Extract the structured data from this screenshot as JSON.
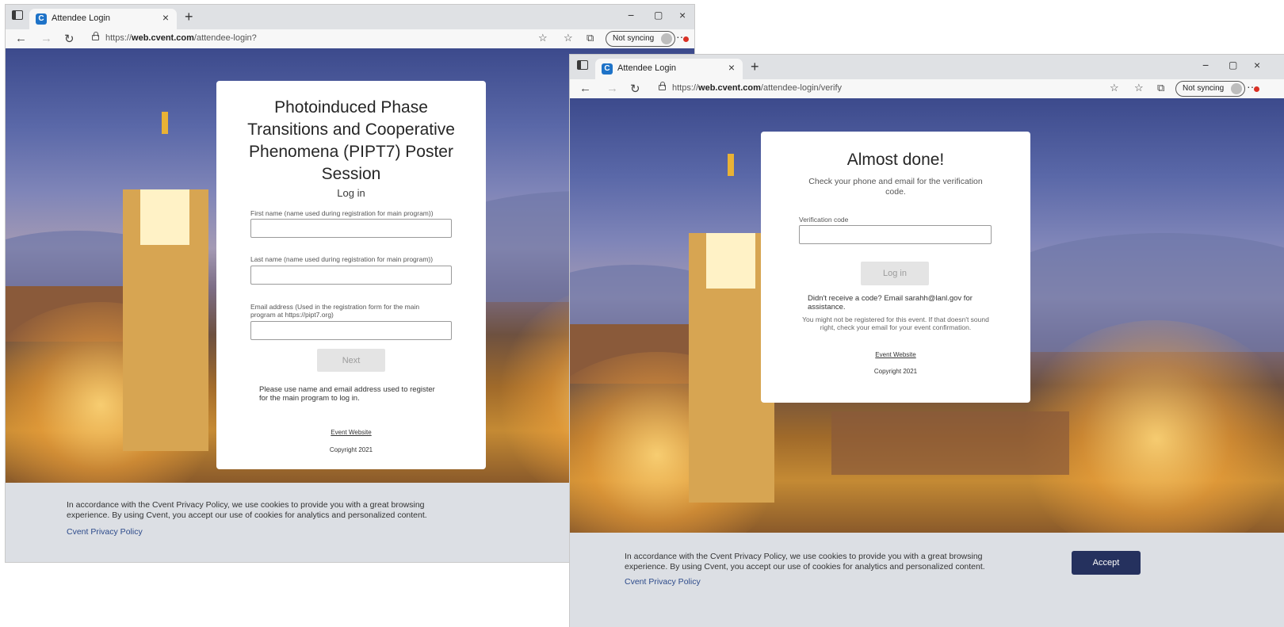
{
  "window1": {
    "tab_title": "Attendee Login",
    "url_prefix": "https://",
    "url_domain": "web.cvent.com",
    "url_path": "/attendee-login?",
    "sync_label": "Not syncing",
    "card": {
      "title": "Photoinduced Phase Transitions and Cooperative Phenomena (PIPT7) Poster Session",
      "subtitle": "Log in",
      "first_name_label": "First name (name used during registration for main program))",
      "last_name_label": "Last name (name used during registration for main program))",
      "email_label": "Email address (Used in the registration form for the main program at https://pipt7.org)",
      "next_button": "Next",
      "note": "Please use name and email address used to register for the main program to log in.",
      "event_website": "Event Website",
      "copyright": "Copyright 2021"
    },
    "cookie_banner": {
      "text": "In accordance with the Cvent Privacy Policy, we use cookies to provide you with a great browsing experience. By using Cvent, you accept our use of cookies for analytics and personalized content.",
      "policy_link": "Cvent Privacy Policy"
    }
  },
  "window2": {
    "tab_title": "Attendee Login",
    "url_prefix": "https://",
    "url_domain": "web.cvent.com",
    "url_path": "/attendee-login/verify",
    "sync_label": "Not syncing",
    "card": {
      "title": "Almost done!",
      "instruction": "Check your phone and email for the verification code.",
      "code_label": "Verification code",
      "login_button": "Log in",
      "help_text": "Didn't receive a code? Email sarahh@lanl.gov for assistance.",
      "registration_note": "You might not be registered for this event. If that doesn't sound right, check your email for your event confirmation.",
      "event_website": "Event Website",
      "copyright": "Copyright 2021"
    },
    "cookie_banner": {
      "text": "In accordance with the Cvent Privacy Policy, we use cookies to provide you with a great browsing experience. By using Cvent, you accept our use of cookies for analytics and personalized content.",
      "policy_link": "Cvent Privacy Policy",
      "accept_button": "Accept"
    }
  },
  "icons": {
    "favicon": "C",
    "close": "×",
    "new_tab": "+",
    "minimize": "−",
    "maximize": "▢",
    "back": "←",
    "forward": "→",
    "reload": "↻",
    "read_aloud": "☆",
    "favorites": "☆",
    "collections": "⧉",
    "more": "···"
  },
  "colors": {
    "accept_button": "#25315e",
    "cookie_banner": "#dcdfe4",
    "favicon": "#1e73c8"
  }
}
